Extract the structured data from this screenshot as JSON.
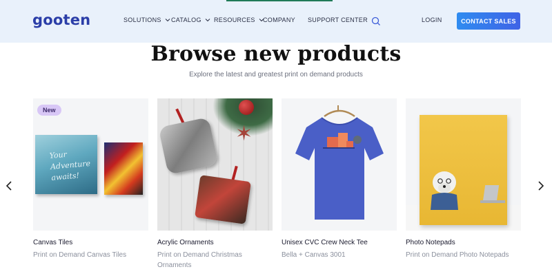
{
  "header": {
    "logo": "gooten",
    "nav": [
      {
        "label": "SOLUTIONS",
        "has_dropdown": true
      },
      {
        "label": "CATALOG",
        "has_dropdown": true
      },
      {
        "label": "RESOURCES",
        "has_dropdown": true
      },
      {
        "label": "COMPANY",
        "has_dropdown": false
      },
      {
        "label": "SUPPORT CENTER",
        "has_dropdown": false
      }
    ],
    "search_icon": "search-icon",
    "login": "LOGIN",
    "contact": "CONTACT SALES",
    "accent_color": "#3f63e6"
  },
  "section": {
    "title": "Browse new products",
    "subtitle": "Explore the latest and greatest print on demand products"
  },
  "carousel": {
    "prev_icon": "chevron-left-icon",
    "next_icon": "chevron-right-icon",
    "products": [
      {
        "badge": "New",
        "title": "Canvas Tiles",
        "subtitle": "Print on Demand Canvas Tiles",
        "tile_text": "Your Adventure awaits!"
      },
      {
        "title": "Acrylic Ornaments",
        "subtitle": "Print on Demand Christmas Ornaments"
      },
      {
        "title": "Unisex CVC Crew Neck Tee",
        "subtitle": "Bella + Canvas 3001"
      },
      {
        "title": "Photo Notepads",
        "subtitle": "Print on Demand Photo Notepads"
      }
    ]
  }
}
